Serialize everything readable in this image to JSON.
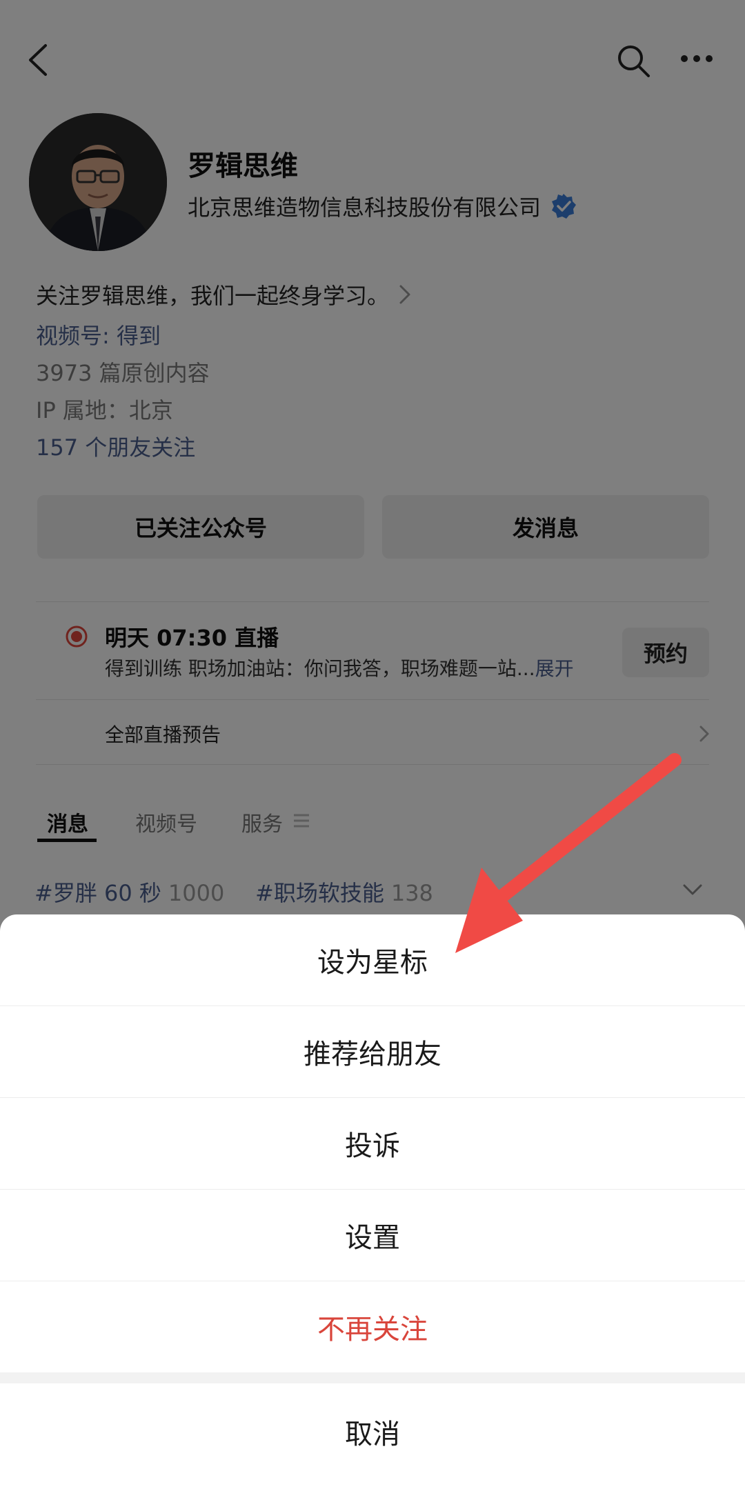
{
  "nav": {
    "back_icon": "chevron-left-icon",
    "search_icon": "search-icon",
    "more_icon": "more-dots-icon"
  },
  "profile": {
    "name": "罗辑思维",
    "company": "北京思维造物信息科技股份有限公司",
    "verified_icon": "verified-badge-icon",
    "bio": "关注罗辑思维，我们一起终身学习。",
    "channel": "视频号: 得到",
    "article_count": "3973 篇原创内容",
    "ip_location": "IP 属地：北京",
    "friends_follow": "157 个朋友关注"
  },
  "actions": {
    "followed_label": "已关注公众号",
    "message_label": "发消息"
  },
  "live": {
    "title": "明天 07:30 直播",
    "description": "得到训练 职场加油站：你问我答，职场难题一站...",
    "expand_label": "展开",
    "reserve_label": "预约",
    "all_label": "全部直播预告"
  },
  "tabs": [
    {
      "label": "消息",
      "active": true
    },
    {
      "label": "视频号",
      "active": false
    },
    {
      "label": "服务",
      "active": false
    }
  ],
  "hashtags": [
    {
      "name": "#罗胖 60 秒",
      "count": "1000"
    },
    {
      "name": "#职场软技能",
      "count": "138"
    }
  ],
  "sheet": {
    "items": [
      {
        "label": "设为星标"
      },
      {
        "label": "推荐给朋友"
      },
      {
        "label": "投诉"
      },
      {
        "label": "设置"
      },
      {
        "label": "不再关注"
      }
    ],
    "cancel_label": "取消"
  },
  "colors": {
    "link": "#4a5e8f",
    "danger": "#d9453b",
    "live_red": "#e0473c",
    "verified_blue": "#3b7dd8",
    "annotation_arrow": "#f04a45"
  }
}
